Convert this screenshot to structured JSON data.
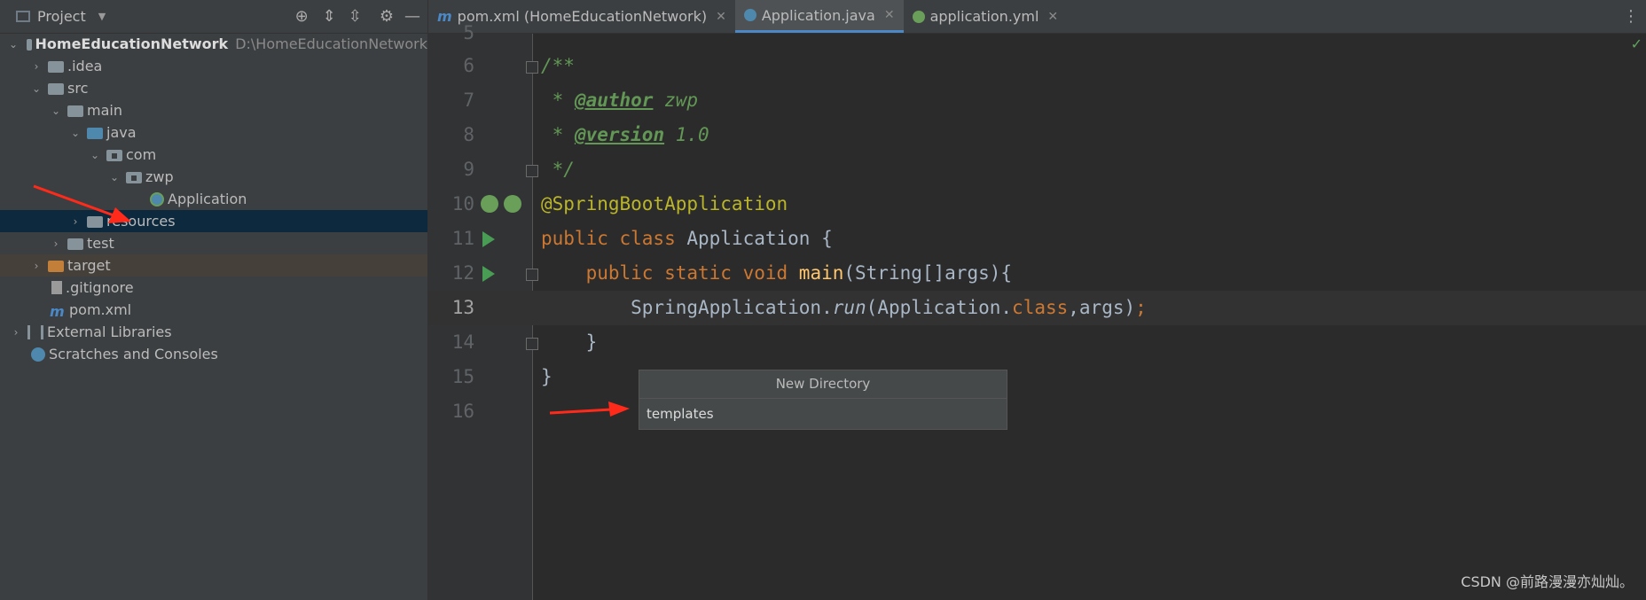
{
  "project_panel": {
    "title": "Project",
    "tree": [
      {
        "label": "HomeEducationNetwork",
        "path": "D:\\HomeEducationNetwork"
      },
      {
        "label": ".idea"
      },
      {
        "label": "src"
      },
      {
        "label": "main"
      },
      {
        "label": "java"
      },
      {
        "label": "com"
      },
      {
        "label": "zwp"
      },
      {
        "label": "Application"
      },
      {
        "label": "resources"
      },
      {
        "label": "test"
      },
      {
        "label": "target"
      },
      {
        "label": ".gitignore"
      },
      {
        "label": "pom.xml"
      },
      {
        "label": "External Libraries"
      },
      {
        "label": "Scratches and Consoles"
      }
    ]
  },
  "tabs": [
    {
      "label": "pom.xml (HomeEducationNetwork)",
      "active": false
    },
    {
      "label": "Application.java",
      "active": true
    },
    {
      "label": "application.yml",
      "active": false
    }
  ],
  "editor": {
    "lines": [
      "5",
      "6",
      "7",
      "8",
      "9",
      "10",
      "11",
      "12",
      "13",
      "14",
      "15",
      "16"
    ],
    "code": {
      "l6": "/**",
      "l7_star": " * ",
      "l7_tag": "@author",
      "l7_val": " zwp",
      "l8_star": " * ",
      "l8_tag": "@version",
      "l8_val": " 1.0",
      "l9": " */",
      "l10": "@SpringBootApplication",
      "l11_kw": "public class ",
      "l11_rest": "Application {",
      "l12_kw": "    public static void ",
      "l12_fn": "main",
      "l12_rest": "(String[]args){",
      "l13_a": "        SpringApplication.",
      "l13_run": "run",
      "l13_b": "(Application.",
      "l13_class": "class",
      "l13_c": ",args)",
      "l13_semi": ";",
      "l14": "    }",
      "l15": "}"
    }
  },
  "popup": {
    "title": "New Directory",
    "value": "templates"
  },
  "watermark": "CSDN @前路漫漫亦灿灿。"
}
